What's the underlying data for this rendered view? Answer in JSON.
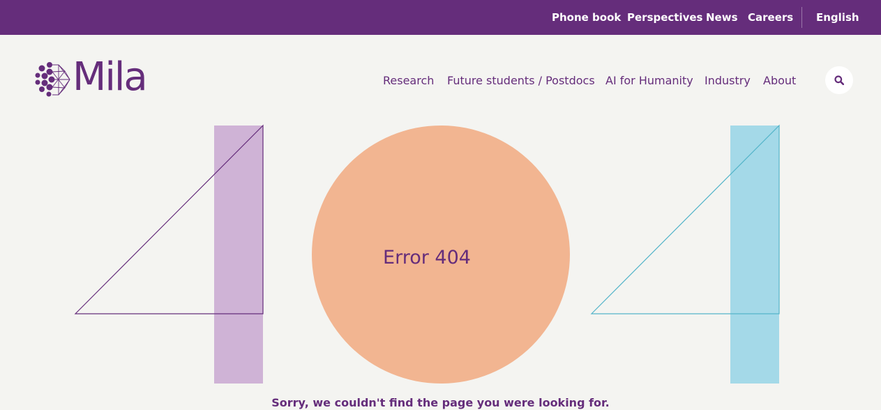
{
  "topbar": {
    "links": [
      "Phone book",
      "Perspectives",
      "News",
      "Careers"
    ],
    "language": "English"
  },
  "brand": {
    "logo_text": "Mila",
    "logo_icon": "mila-dots-icon"
  },
  "nav": {
    "items": [
      "Research",
      "Future students / Postdocs",
      "AI for Humanity",
      "Industry",
      "About"
    ],
    "search_icon": "search-icon"
  },
  "error": {
    "title": "Error 404",
    "message": "Sorry, we couldn't find the page you were looking for."
  },
  "colors": {
    "purple": "#652d7b",
    "background": "#f4f4f1",
    "lavender": "#cfb3d6",
    "peach": "#f2b591",
    "light_blue": "#a4d9e8",
    "teal_line": "#53b4c9"
  }
}
